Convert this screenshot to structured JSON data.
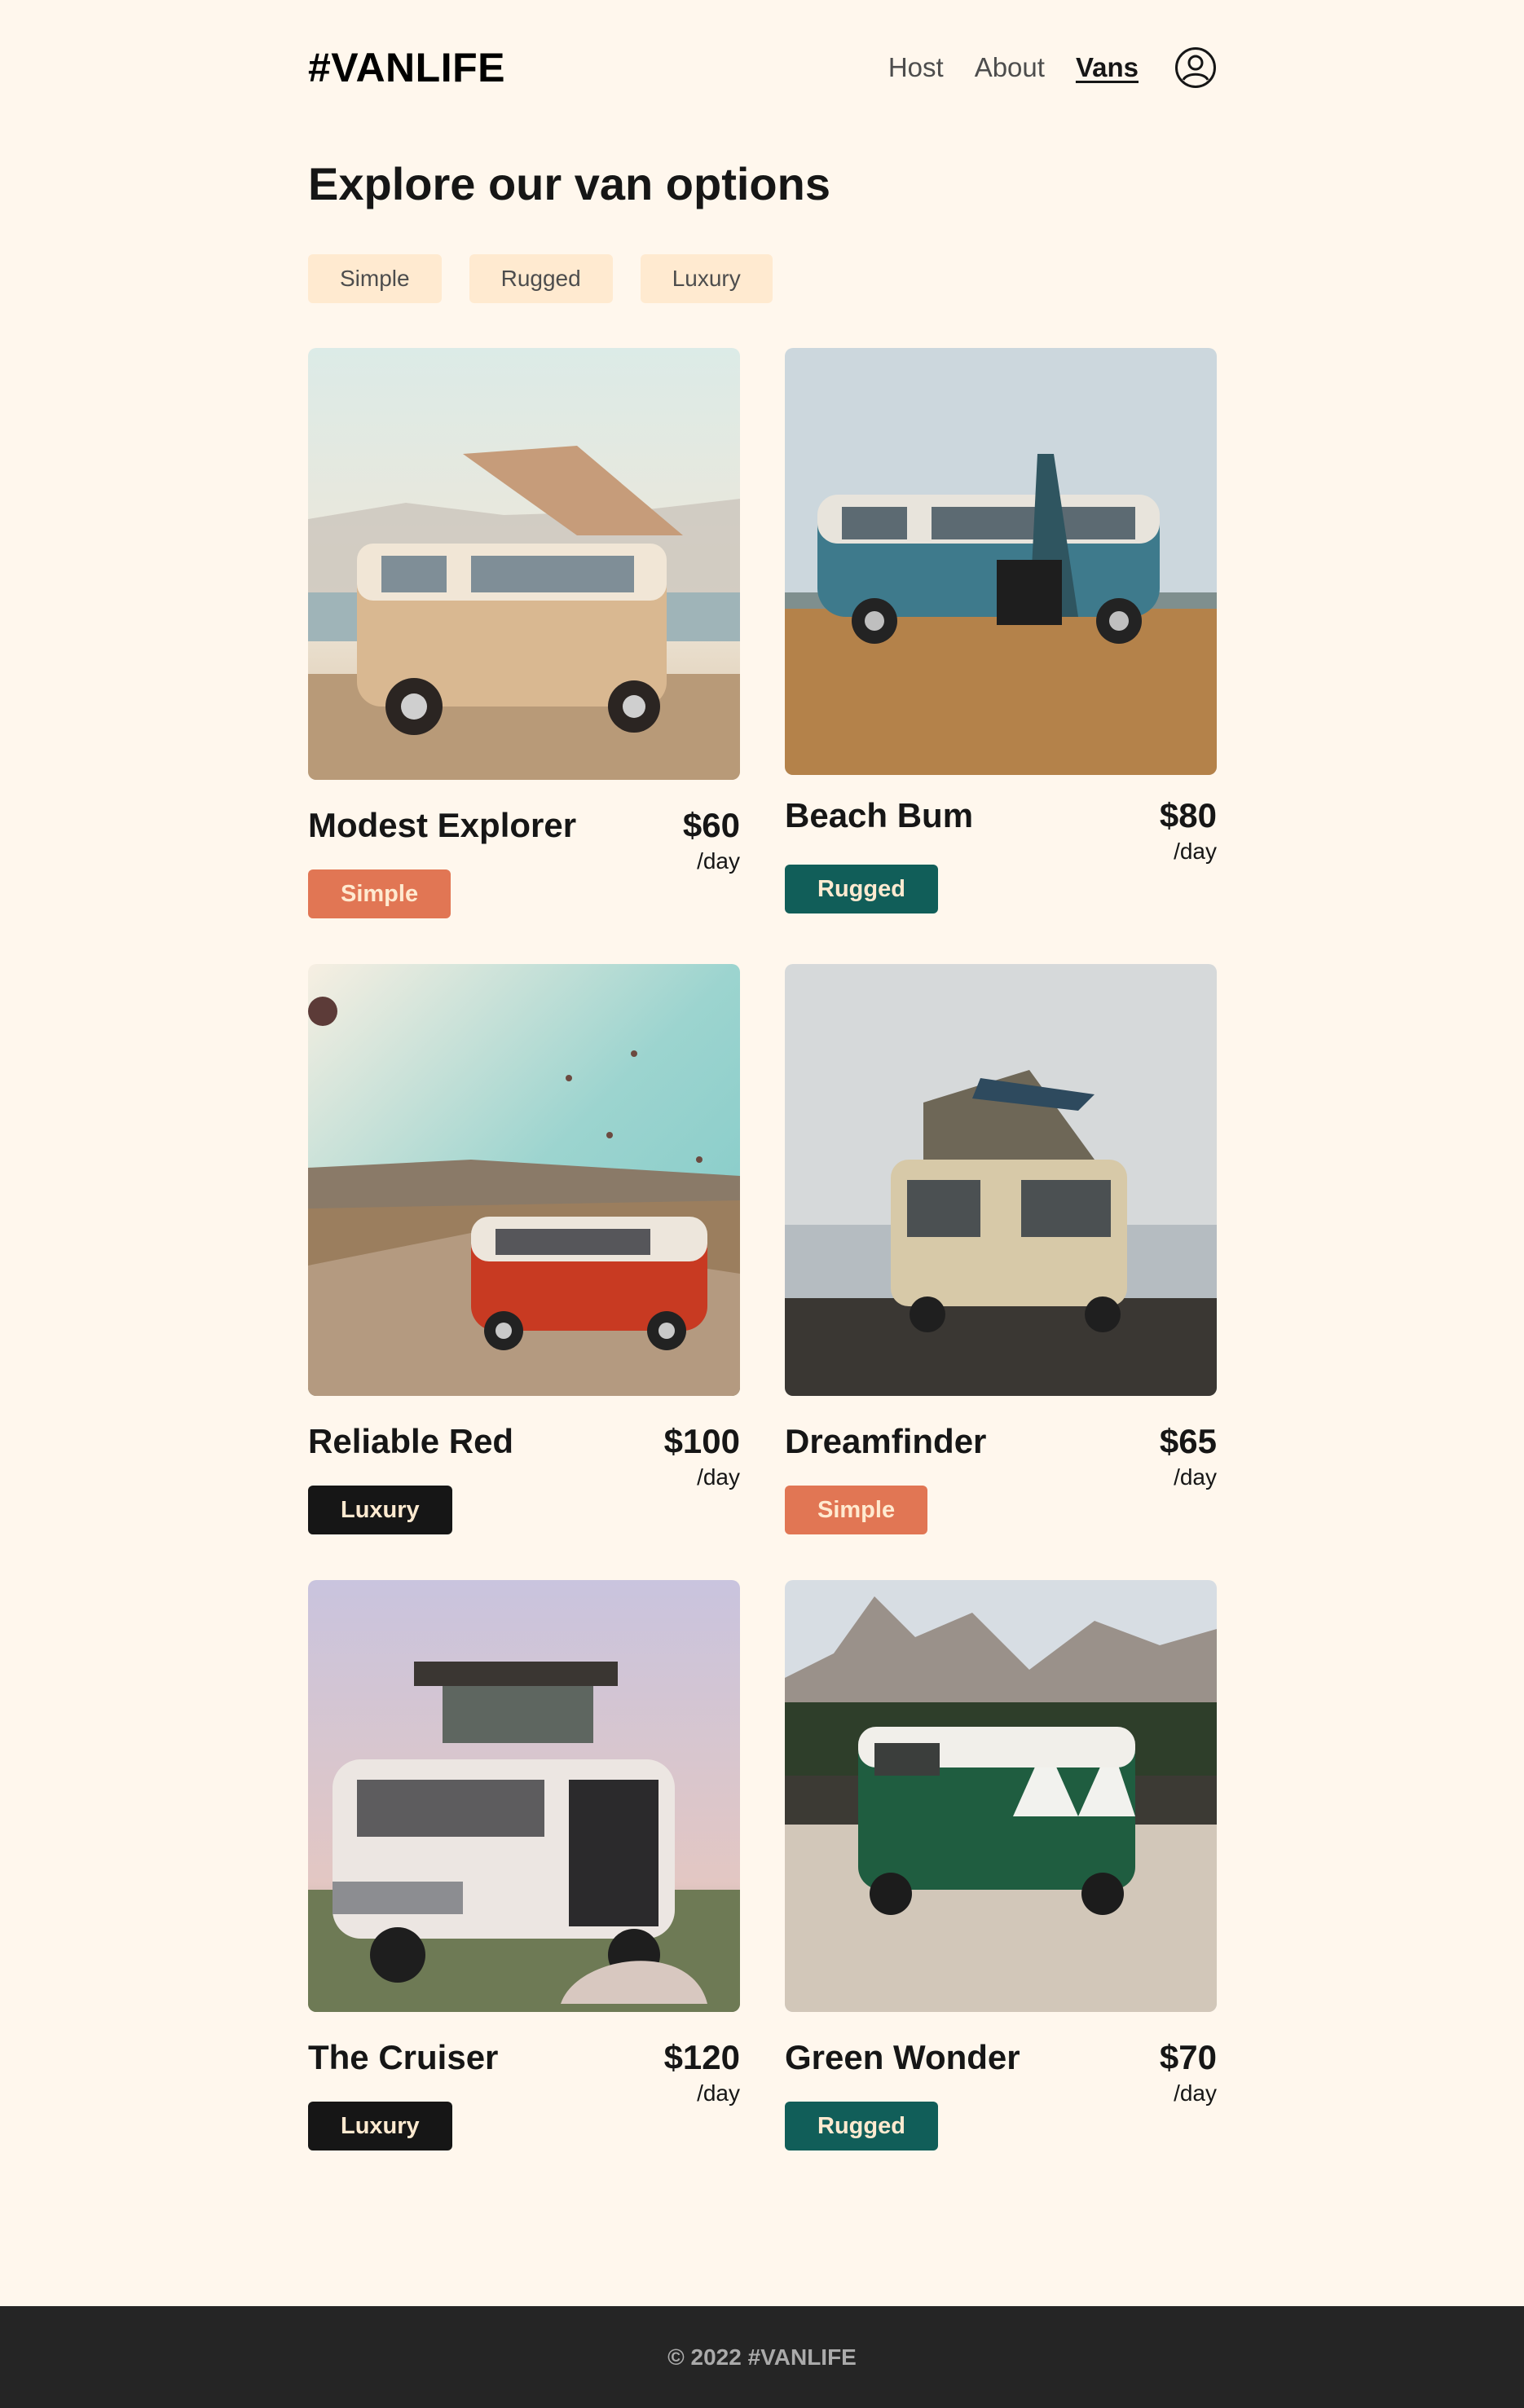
{
  "header": {
    "logo": "#VANLIFE",
    "nav": [
      {
        "label": "Host",
        "active": false
      },
      {
        "label": "About",
        "active": false
      },
      {
        "label": "Vans",
        "active": true
      }
    ],
    "user_icon": "user-circle-icon"
  },
  "page": {
    "title": "Explore our van options"
  },
  "filters": [
    "Simple",
    "Rugged",
    "Luxury"
  ],
  "vans": [
    {
      "name": "Modest Explorer",
      "price": "$60",
      "per": "/day",
      "type": "Simple",
      "image": "beige-van-photo"
    },
    {
      "name": "Beach Bum",
      "price": "$80",
      "per": "/day",
      "type": "Rugged",
      "image": "blue-van-photo"
    },
    {
      "name": "Reliable Red",
      "price": "$100",
      "per": "/day",
      "type": "Luxury",
      "image": "red-van-photo"
    },
    {
      "name": "Dreamfinder",
      "price": "$65",
      "per": "/day",
      "type": "Simple",
      "image": "cream-van-photo"
    },
    {
      "name": "The Cruiser",
      "price": "$120",
      "per": "/day",
      "type": "Luxury",
      "image": "white-van-photo"
    },
    {
      "name": "Green Wonder",
      "price": "$70",
      "per": "/day",
      "type": "Rugged",
      "image": "green-van-photo"
    }
  ],
  "colors": {
    "background": "#FFF7ED",
    "simple": "#E17654",
    "rugged": "#115E59",
    "luxury": "#161616",
    "filter_bg": "#FFEAD0"
  },
  "footer": {
    "text": "© 2022 #VANLIFE"
  }
}
